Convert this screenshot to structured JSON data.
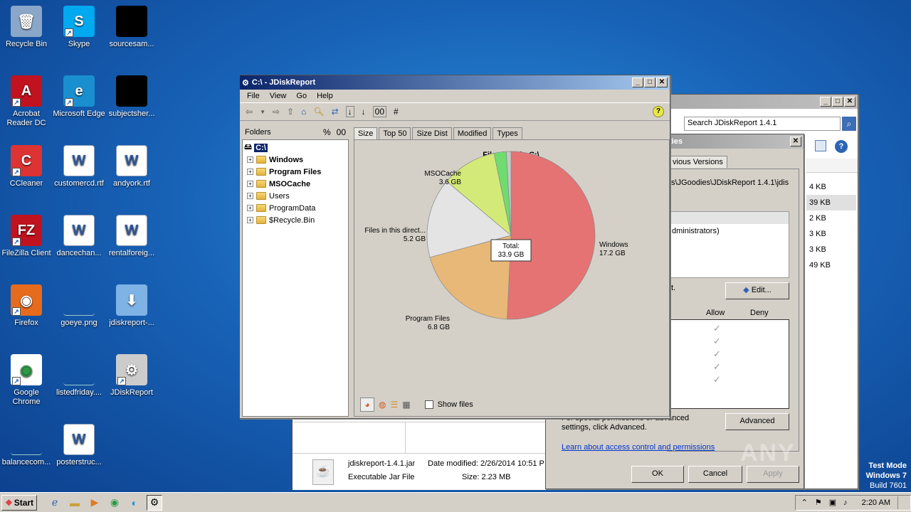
{
  "desktop": {
    "icons": [
      {
        "label": "Recycle Bin",
        "icon": "recycle-bin-icon"
      },
      {
        "label": "Skype",
        "icon": "skype-icon"
      },
      {
        "label": "sourcesam...",
        "icon": "blank-file-icon"
      },
      {
        "label": "Acrobat Reader DC",
        "icon": "acrobat-icon"
      },
      {
        "label": "Microsoft Edge",
        "icon": "edge-icon"
      },
      {
        "label": "subjectsher...",
        "icon": "blank-file-icon"
      },
      {
        "label": "CCleaner",
        "icon": "ccleaner-icon"
      },
      {
        "label": "customercd.rtf",
        "icon": "word-doc-icon"
      },
      {
        "label": "andyork.rtf",
        "icon": "word-doc-icon"
      },
      {
        "label": "FileZilla Client",
        "icon": "filezilla-icon"
      },
      {
        "label": "dancechan...",
        "icon": "word-doc-icon"
      },
      {
        "label": "rentalforeig...",
        "icon": "word-doc-icon"
      },
      {
        "label": "Firefox",
        "icon": "firefox-icon"
      },
      {
        "label": "goeye.png",
        "icon": "image-file-icon"
      },
      {
        "label": "jdiskreport-...",
        "icon": "installer-icon"
      },
      {
        "label": "Google Chrome",
        "icon": "chrome-icon"
      },
      {
        "label": "listedfriday....",
        "icon": "image-file-icon"
      },
      {
        "label": "JDiskReport",
        "icon": "jdiskreport-icon"
      },
      {
        "label": "balancecom...",
        "icon": "image-file-icon"
      },
      {
        "label": "posterstruc...",
        "icon": "word-doc-icon"
      }
    ]
  },
  "explorer": {
    "search_placeholder": "Search JDiskReport 1.4.1",
    "sizes": [
      "4 KB",
      "39 KB",
      "2 KB",
      "3 KB",
      "3 KB",
      "49 KB"
    ],
    "file_name": "jdiskreport-1.4.1.jar",
    "date_modified": "Date modified: 2/26/2014 10:51 P",
    "file_type": "Executable Jar File",
    "size": "Size: 2.23 MB"
  },
  "properties": {
    "title_partial": "ties",
    "tab_partial": "vious Versions",
    "path_partial": "s\\JGoodies\\JDiskReport 1.4.1\\jdis",
    "group_partial": "dministrators)",
    "change_partial": "t.",
    "edit_label": "Edit...",
    "allow_label": "Allow",
    "deny_label": "Deny",
    "special_text": "For special permissions or advanced settings, click Advanced.",
    "advanced_label": "Advanced",
    "link_text": "Learn about access control and permissions",
    "ok_label": "OK",
    "cancel_label": "Cancel",
    "apply_label": "Apply"
  },
  "jdisk": {
    "title": "C:\\ - JDiskReport",
    "menu": [
      "File",
      "View",
      "Go",
      "Help"
    ],
    "folders_label": "Folders",
    "folders_pct": "%",
    "folders_00": "00",
    "tree_root": "C:\\",
    "tree": [
      {
        "label": "Windows",
        "bold": true
      },
      {
        "label": "Program Files",
        "bold": true
      },
      {
        "label": "MSOCache",
        "bold": true
      },
      {
        "label": "Users",
        "bold": false
      },
      {
        "label": "ProgramData",
        "bold": false
      },
      {
        "label": "$Recycle.Bin",
        "bold": false
      }
    ],
    "tabs": [
      "Size",
      "Top 50",
      "Size Dist",
      "Modified",
      "Types"
    ],
    "toolbar_00": "00",
    "toolbar_hash": "#",
    "show_files": "Show files",
    "total_label": "Total:",
    "total_value": "33.9 GB"
  },
  "chart_data": {
    "type": "pie",
    "title": "File sizes in C:\\",
    "unit": "GB",
    "slices": [
      {
        "label": "Windows",
        "value": 17.2,
        "display": "17.2 GB",
        "color": "#e57373"
      },
      {
        "label": "Program Files",
        "value": 6.8,
        "display": "6.8 GB",
        "color": "#e8b878"
      },
      {
        "label": "Files in this direct...",
        "value": 5.2,
        "display": "5.2 GB",
        "color": "#e4e4e4"
      },
      {
        "label": "MSOCache",
        "value": 3.6,
        "display": "3.6 GB",
        "color": "#d4ea78"
      },
      {
        "label": "",
        "value": 0.8,
        "display": "",
        "color": "#6fdc6f"
      },
      {
        "label": "",
        "value": 0.3,
        "display": "",
        "color": "#c8c8c8"
      }
    ]
  },
  "taskbar": {
    "start_label": "Start",
    "clock": "2:20 AM"
  },
  "watermark": {
    "brand": "ANY RUN",
    "test_mode": "Test Mode",
    "os": "Windows 7",
    "build": "Build 7601"
  }
}
